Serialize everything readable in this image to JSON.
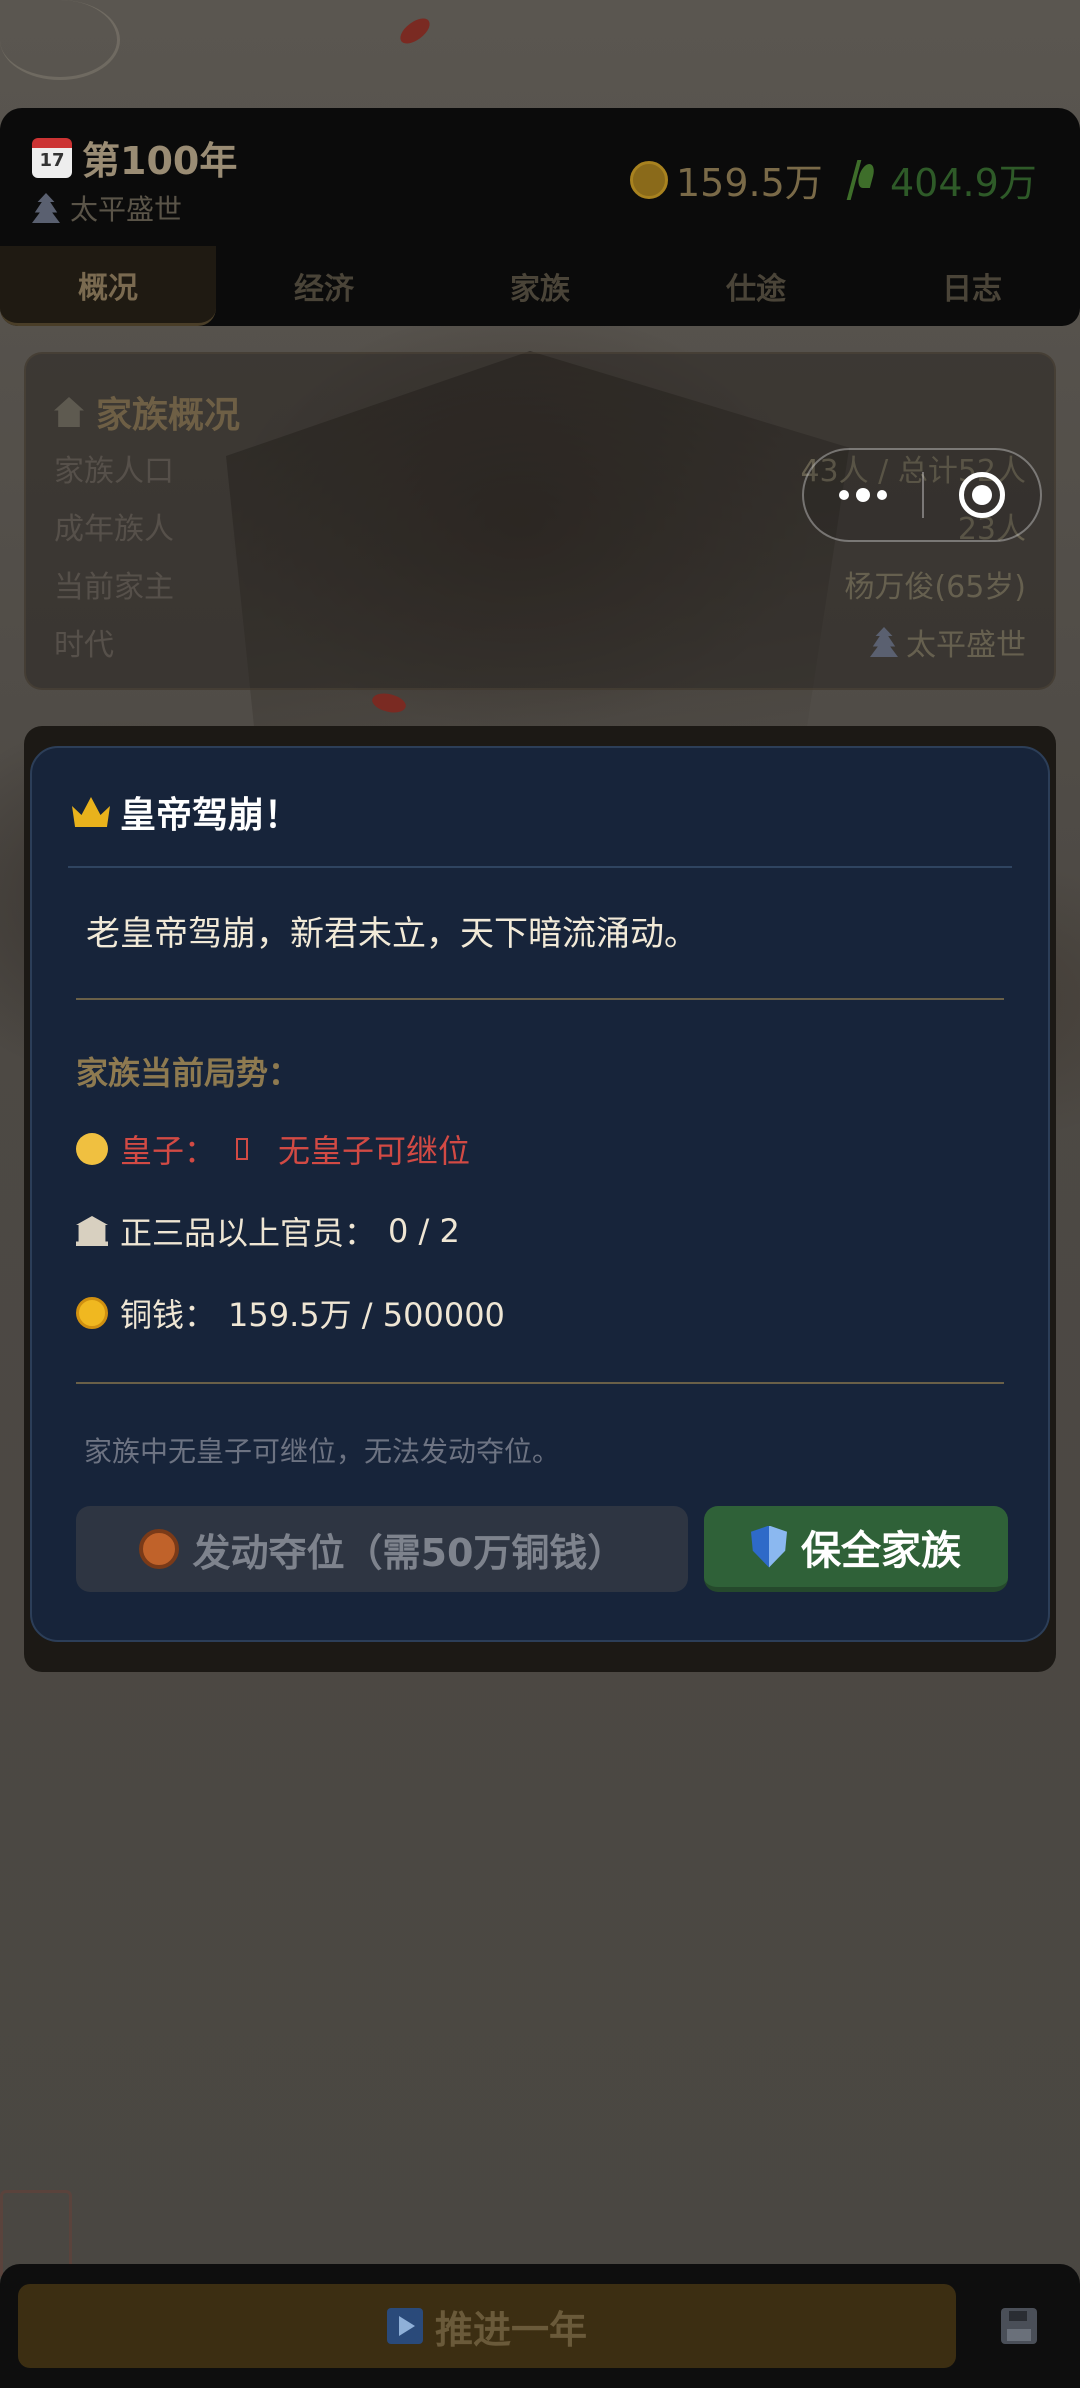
{
  "header": {
    "calendar_day": "17",
    "year": "第100年",
    "era": "太平盛世",
    "copper": "159.5万",
    "grain": "404.9万"
  },
  "tabs": [
    {
      "label": "概况",
      "active": true
    },
    {
      "label": "经济"
    },
    {
      "label": "家族"
    },
    {
      "label": "仕途"
    },
    {
      "label": "日志"
    }
  ],
  "overview": {
    "title": "家族概况",
    "rows": [
      {
        "label": "家族人口",
        "value": "43人 / 总计52人"
      },
      {
        "label": "成年族人",
        "value": "23人"
      },
      {
        "label": "当前家主",
        "value": "杨万俊(65岁)"
      },
      {
        "label": "时代",
        "value": "太平盛世"
      }
    ]
  },
  "modal": {
    "title": "皇帝驾崩！",
    "message": "老皇帝驾崩，新君未立，天下暗流涌动。",
    "situation_label": "家族当前局势：",
    "prince_label": "皇子：",
    "prince_value": "无皇子可继位",
    "officials_label": "正三品以上官员：",
    "officials_value": "0 / 2",
    "copper_label": "铜钱：",
    "copper_value": "159.5万 / 500000",
    "note": "家族中无皇子可继位，无法发动夺位。",
    "usurp_button": "发动夺位（需50万铜钱）",
    "protect_button": "保全家族"
  },
  "bottom": {
    "next_year_button": "推进一年"
  },
  "colors": {
    "modal_bg": "#17243a",
    "protect_green": "#2f6138",
    "alert_red": "#d24a44",
    "gold_label": "#8e7a50"
  },
  "icons": [
    "calendar-icon",
    "pagoda-icon",
    "coin-icon",
    "grain-icon",
    "house-icon",
    "crown-icon",
    "baby-icon",
    "bank-icon",
    "lion-icon",
    "shield-icon",
    "play-icon",
    "floppy-icon",
    "more-icon",
    "close-icon"
  ]
}
